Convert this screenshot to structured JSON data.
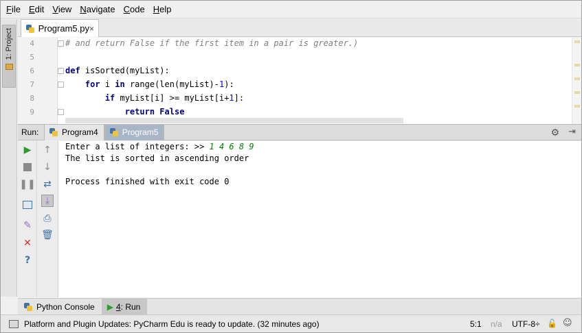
{
  "menu": [
    {
      "pre": "",
      "u": "F",
      "post": "ile"
    },
    {
      "pre": "",
      "u": "E",
      "post": "dit"
    },
    {
      "pre": "",
      "u": "V",
      "post": "iew"
    },
    {
      "pre": "",
      "u": "N",
      "post": "avigate"
    },
    {
      "pre": "",
      "u": "C",
      "post": "ode"
    },
    {
      "pre": "",
      "u": "H",
      "post": "elp"
    }
  ],
  "left_strip": {
    "project_label": "1: Project"
  },
  "editor_tab": {
    "label": "Program5.py",
    "close": "×"
  },
  "editor": {
    "line_numbers": [
      "4",
      "5",
      "6",
      "7",
      "8",
      "9"
    ],
    "line4": "# and return False if the first item in a pair is greater.)",
    "line6_kw": "def",
    "line6_rest": " isSorted(myList):",
    "line7_indent": "    ",
    "line7_kw1": "for",
    "line7_a": " i ",
    "line7_kw2": "in",
    "line7_b": " range(len(myList)-",
    "line7_num": "1",
    "line7_c": "):",
    "line8_indent": "        ",
    "line8_kw": "if",
    "line8_a": " myList[i] >= myList[i+",
    "line8_num": "1",
    "line8_b": "]:",
    "line9_indent": "            ",
    "line9_kw1": "return",
    "line9_sp": " ",
    "line9_kw2": "False"
  },
  "run": {
    "label": "Run:",
    "tabs": [
      "Program4",
      "Program5"
    ],
    "active_tab": "Program5"
  },
  "console": {
    "prompt": "Enter a list of integers: >> ",
    "input": "1 4 6 8 9",
    "result": "The list is sorted in ascending order",
    "exit": "Process finished with exit code 0"
  },
  "tool_tabs": {
    "python_console": "Python Console",
    "run_num": "4",
    "run_rest": ": Run"
  },
  "status": {
    "message": "Platform and Plugin Updates: PyCharm Edu is ready to update. (32 minutes ago)",
    "position": "5:1",
    "line_sep": "n/a",
    "encoding": "UTF-8÷"
  },
  "colors": {
    "keyword": "#000080",
    "comment": "#808080",
    "number": "#0000ff",
    "console_input": "#008000",
    "run_icon": "#2e9b2e",
    "active_tab": "#a8b6c8"
  }
}
